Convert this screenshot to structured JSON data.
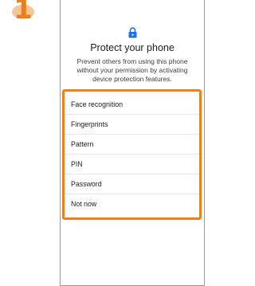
{
  "step": {
    "number": "1"
  },
  "screen": {
    "icon": "lock-icon",
    "title": "Protect your phone",
    "description": "Prevent others from using this phone without your permission by activating device protection features."
  },
  "options": [
    {
      "label": "Face recognition"
    },
    {
      "label": "Fingerprints"
    },
    {
      "label": "Pattern"
    },
    {
      "label": "PIN"
    },
    {
      "label": "Password"
    },
    {
      "label": "Not now"
    }
  ],
  "colors": {
    "accent": "#f07f1c",
    "lock": "#1a73e8",
    "step": "#ef7d1a"
  }
}
